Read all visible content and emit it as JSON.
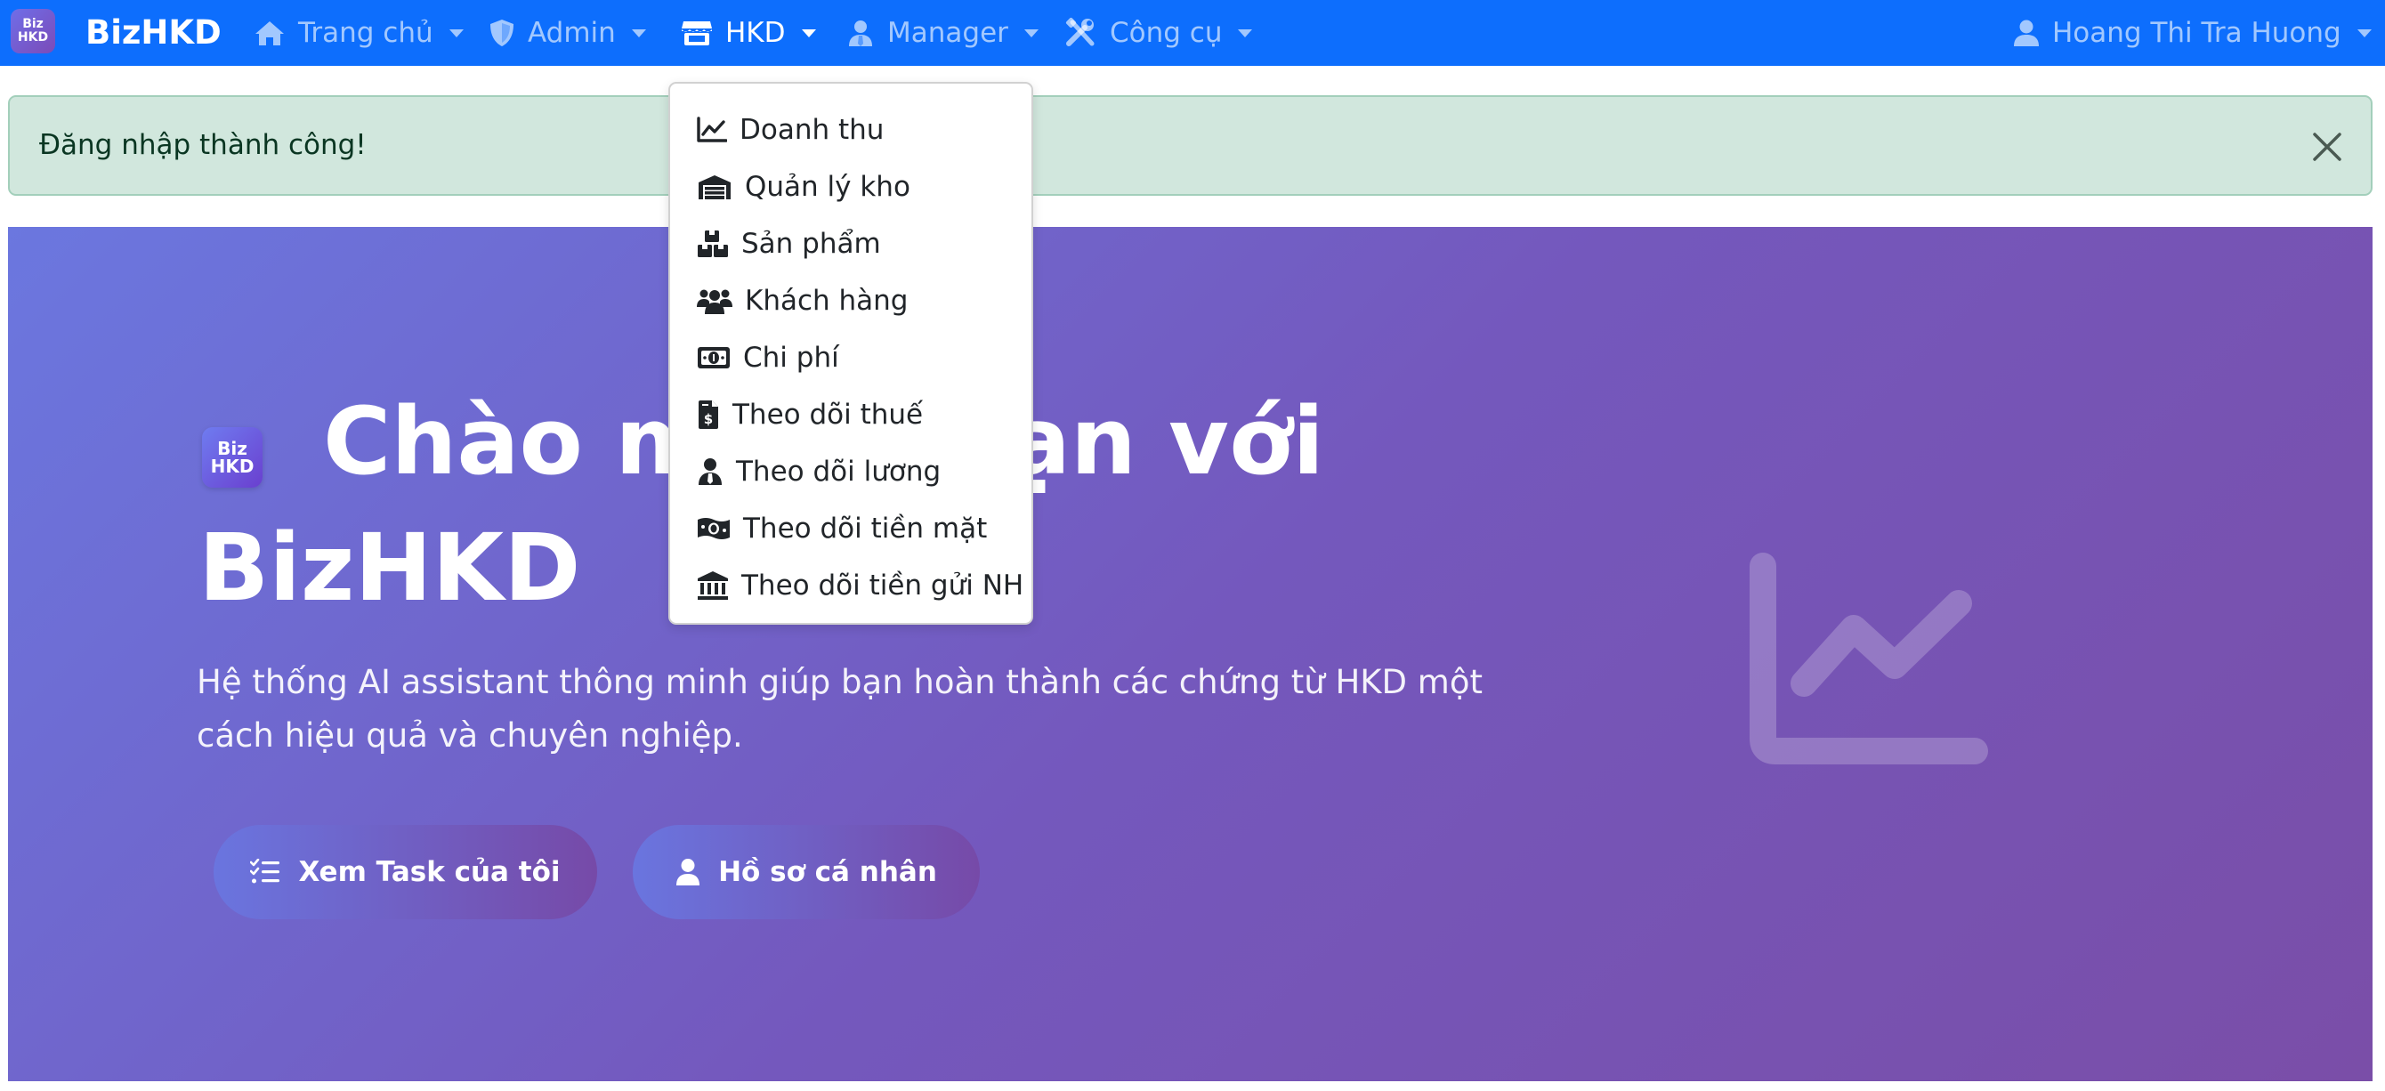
{
  "navbar": {
    "logo_line1": "Biz",
    "logo_line2": "HKD",
    "brand": "BizHKD",
    "items": [
      {
        "label": "Trang chủ",
        "icon": "home-icon"
      },
      {
        "label": "Admin",
        "icon": "shield-icon"
      },
      {
        "label": "HKD",
        "icon": "store-icon",
        "active": true
      },
      {
        "label": "Manager",
        "icon": "user-tie-icon"
      },
      {
        "label": "Công cụ",
        "icon": "tools-icon"
      }
    ],
    "user": {
      "label": "Hoang Thi Tra Huong",
      "icon": "user-icon"
    }
  },
  "alert": {
    "message": "Đăng nhập thành công!",
    "close_icon": "close-icon",
    "bg_color": "#d1e7dd",
    "text_color": "#0a3622"
  },
  "dropdown": {
    "items": [
      {
        "label": "Doanh thu",
        "icon": "chart-line-icon"
      },
      {
        "label": "Quản lý kho",
        "icon": "warehouse-icon"
      },
      {
        "label": "Sản phẩm",
        "icon": "boxes-icon"
      },
      {
        "label": "Khách hàng",
        "icon": "users-icon"
      },
      {
        "label": "Chi phí",
        "icon": "money-bill-icon"
      },
      {
        "label": "Theo dõi thuế",
        "icon": "file-invoice-dollar-icon"
      },
      {
        "label": "Theo dõi lương",
        "icon": "user-tie-icon"
      },
      {
        "label": "Theo dõi tiền mặt",
        "icon": "money-bill-wave-icon"
      },
      {
        "label": "Theo dõi tiền gửi NH",
        "icon": "bank-icon"
      }
    ]
  },
  "hero": {
    "logo_line1": "Biz",
    "logo_line2": "HKD",
    "title": "Chào mừng bạn với BizHKD",
    "subtitle": "Hệ thống AI assistant thông minh giúp bạn hoàn thành các chứng từ HKD một cách hiệu quả và chuyên nghiệp.",
    "btn_tasks": "Xem Task của tôi",
    "btn_profile": "Hồ sơ cá nhân",
    "decoration_icon": "chart-line-icon"
  },
  "colors": {
    "navbar": "#0d6efd",
    "hero_gradient_start": "#6b77df",
    "hero_gradient_end": "#7a4ea8"
  }
}
